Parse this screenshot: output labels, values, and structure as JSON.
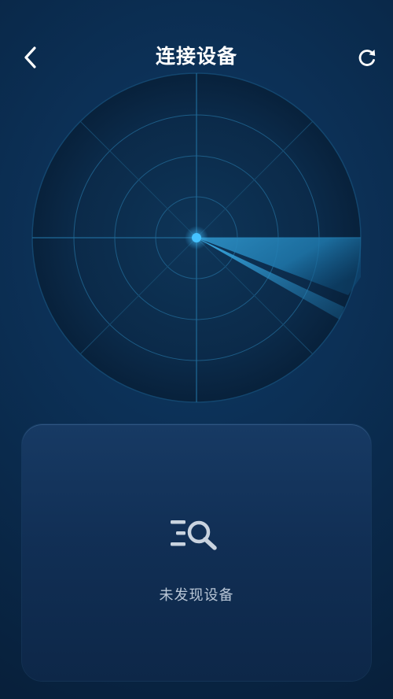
{
  "header": {
    "title": "连接设备",
    "back_icon": "chevron-left-icon",
    "refresh_icon": "refresh-icon"
  },
  "radar": {
    "accent_color": "#3fb7f2",
    "ring_color": "#1d5c86"
  },
  "empty_state": {
    "icon": "search-list-icon",
    "message": "未发现设备"
  }
}
